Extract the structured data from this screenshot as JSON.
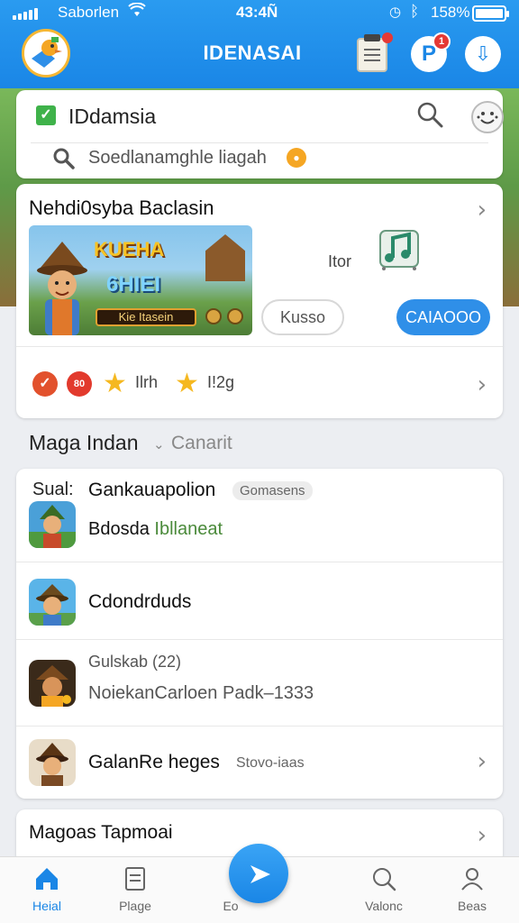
{
  "status_bar": {
    "carrier": "Saborlen",
    "time": "43:4Ñ",
    "battery": "158%",
    "battery_level": 1.0
  },
  "header": {
    "title": "IDENASAI",
    "profile_letter": "P",
    "notification_count": "1"
  },
  "search_card": {
    "brand": "IDdamsia",
    "placeholder": "Soedlanamghle liagah"
  },
  "featured": {
    "title": "Nehdi0syba Baclasin",
    "banner_line1": "KUEHA",
    "banner_line2": "6HIEI",
    "banner_button": "Kie Itasein",
    "store_label": "Itor",
    "outline_button": "Kusso",
    "primary_button": "CAIAOOO",
    "rating_badge_2": "80",
    "rating_1": "Ilrh",
    "rating_2": "I!2g"
  },
  "section1": {
    "title": "Maga Indan",
    "subtitle": "Canarit"
  },
  "list": {
    "row1": {
      "lead": "Sual:",
      "name": "Gankauapolion",
      "tag": "Gomasens",
      "sub_a": "Bdosda ",
      "sub_b": "Ibllaneat"
    },
    "row2": {
      "name": "Cdondrduds"
    },
    "row3": {
      "meta": "Gulskab (22)",
      "name": "NoiekanCarloen",
      "price": " Padk–1333"
    },
    "row4": {
      "name": "GalanRe heges",
      "sub": "Stovo-iaas"
    }
  },
  "section2": {
    "title": "Magoas Tapmoai"
  },
  "tabs": [
    {
      "label": "Heial",
      "icon": "home-icon"
    },
    {
      "label": "Plage",
      "icon": "document-icon"
    },
    {
      "label": "Eo",
      "icon": "play-icon"
    },
    {
      "label": "Valonc",
      "icon": "search-icon"
    },
    {
      "label": "Beas",
      "icon": "person-icon"
    }
  ],
  "colors": {
    "accent": "#1a86e6",
    "header": "#2a9bf0",
    "star": "#f5b820",
    "badge_red": "#e53935",
    "check_green": "#3fb24a"
  }
}
